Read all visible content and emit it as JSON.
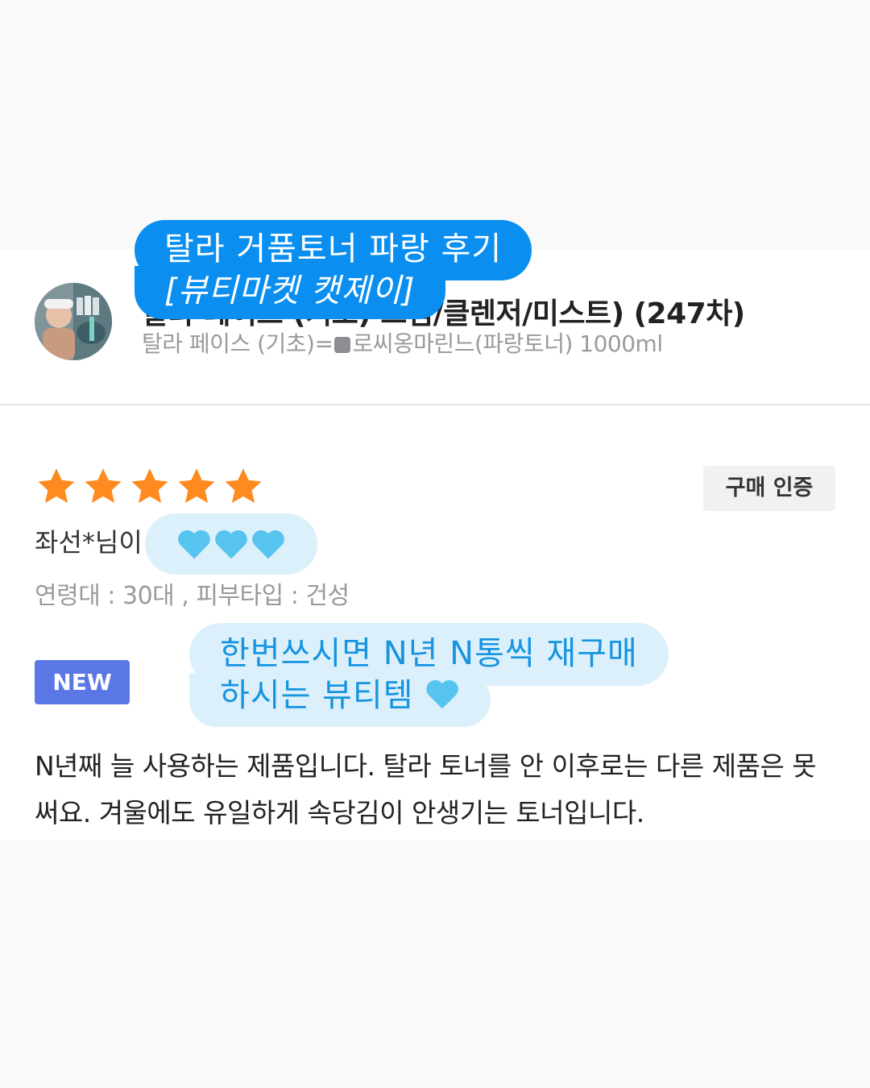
{
  "product": {
    "title": "탈라 페이스 (기초) 크림/클렌저/미스트) (247차)",
    "option_prefix": "탈라 페이스 (기초)=",
    "option_suffix": "로씨옹마린느(파랑토너) 1000ml"
  },
  "overlay_title": {
    "line1": "탈라 거품토너 파랑 후기",
    "line2": "[뷰티마켓 캣제이]"
  },
  "review": {
    "rating": 5,
    "rating_max": 5,
    "star_color": "#ff8a1f",
    "verified_label": "구매 인증",
    "reviewer": "좌선*님이",
    "meta": "연령대 : 30대 , 피부타입 : 건성",
    "new_label": "NEW",
    "body": "N년째 늘 사용하는 제품입니다. 탈라 토너를 안 이후로는 다른 제품은 못 써요. 겨울에도 유일하게 속당김이 안생기는 토너입니다."
  },
  "overlay_hearts": {
    "count": 3,
    "icon": "light-blue-heart-icon",
    "color": "#56c4ee"
  },
  "overlay_note": {
    "line1": "한번쓰시면 N년 N통씩 재구매",
    "line2": "하시는 뷰티템"
  }
}
